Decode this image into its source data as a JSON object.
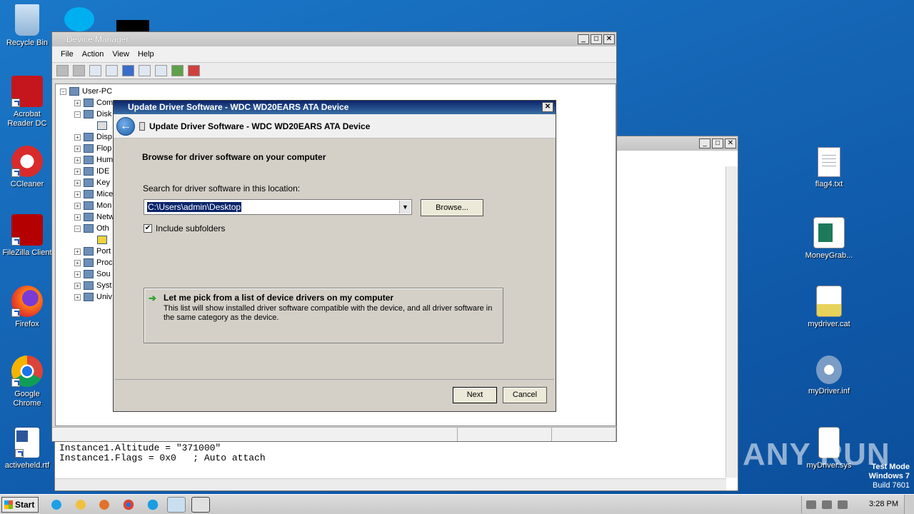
{
  "desktop": {
    "left_icons": [
      {
        "label": "Recycle Bin",
        "icon": "recycle-bin-icon"
      },
      {
        "label": "Acrobat Reader DC",
        "icon": "acrobat-icon"
      },
      {
        "label": "CCleaner",
        "icon": "ccleaner-icon"
      },
      {
        "label": "FileZilla Client",
        "icon": "filezilla-icon"
      },
      {
        "label": "Firefox",
        "icon": "firefox-icon"
      },
      {
        "label": "Google Chrome",
        "icon": "chrome-icon"
      },
      {
        "label": "activeheld.rtf",
        "icon": "word-document-icon"
      }
    ],
    "right_icons": [
      {
        "label": "flag4.txt",
        "icon": "text-file-icon"
      },
      {
        "label": "MoneyGrab...",
        "icon": "image-file-icon"
      },
      {
        "label": "mydriver.cat",
        "icon": "catalog-file-icon"
      },
      {
        "label": "myDriver.inf",
        "icon": "setup-info-icon"
      },
      {
        "label": "myDriver.sys",
        "icon": "system-file-icon"
      }
    ],
    "watermark": "ANY RUN",
    "test_mode": {
      "line1": "Test Mode",
      "line2": "Windows 7",
      "line3": "Build 7601"
    }
  },
  "device_manager": {
    "title": "Device Manager",
    "menu": [
      "File",
      "Action",
      "View",
      "Help"
    ],
    "root": "User-PC",
    "tree": [
      "Com",
      "Disk",
      "",
      "Disp",
      "Flop",
      "Hum",
      "IDE",
      "Key",
      "Mice",
      "Mon",
      "Netw",
      "Oth",
      "",
      "Port",
      "Proc",
      "Sou",
      "Syst",
      "Univ"
    ]
  },
  "notepad": {
    "lines": [
      "Instance1.Altitude = \"371000\"",
      "Instance1.Flags = 0x0   ; Auto attach"
    ]
  },
  "dialog": {
    "title": "Update Driver Software - WDC WD20EARS ATA Device",
    "header": "Update Driver Software - WDC WD20EARS ATA Device",
    "heading": "Browse for driver software on your computer",
    "search_label": "Search for driver software in this location:",
    "path_value": "C:\\Users\\admin\\Desktop",
    "browse_label": "Browse...",
    "include_subfolders": "Include subfolders",
    "include_checked": true,
    "option_title": "Let me pick from a list of device drivers on my computer",
    "option_desc": "This list will show installed driver software compatible with the device, and all driver software in the same category as the device.",
    "next_label": "Next",
    "cancel_label": "Cancel"
  },
  "taskbar": {
    "start_label": "Start",
    "clock": "3:28 PM"
  },
  "colors": {
    "desktop": "#1565b5",
    "dialog_title": "#0a246a",
    "selection": "#0a246a"
  }
}
